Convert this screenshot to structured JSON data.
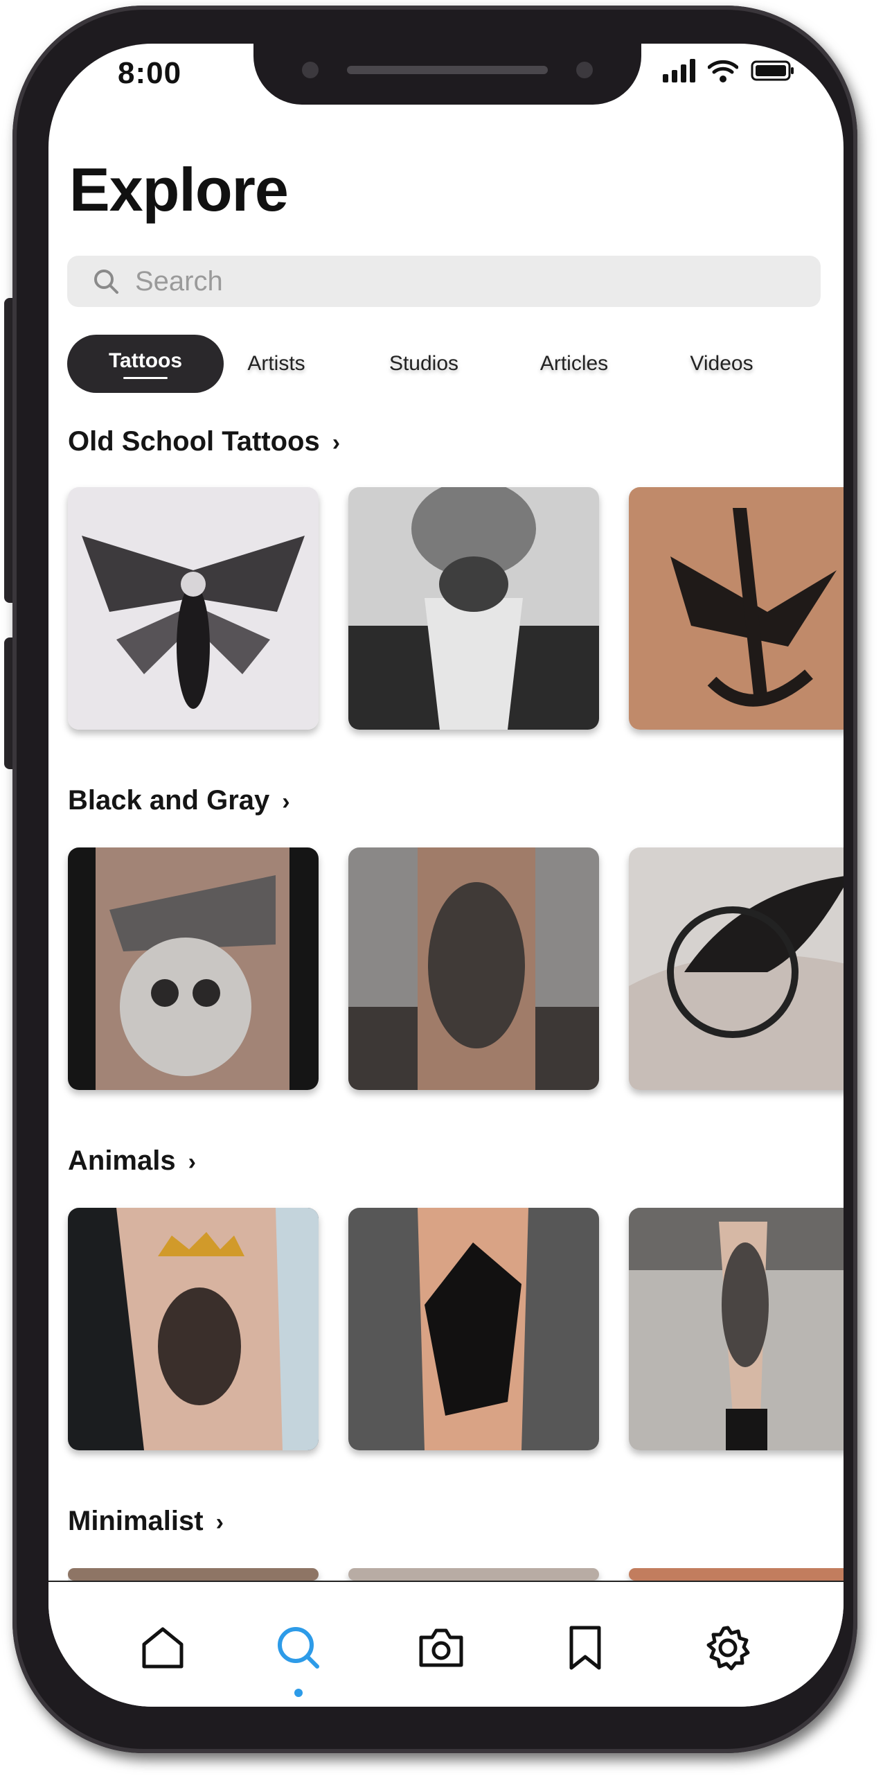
{
  "status_bar": {
    "time": "8:00"
  },
  "page_title": "Explore",
  "search": {
    "placeholder": "Search"
  },
  "tabs": [
    {
      "label": "Tattoos",
      "active": true
    },
    {
      "label": "Artists"
    },
    {
      "label": "Studios"
    },
    {
      "label": "Articles"
    },
    {
      "label": "Videos"
    }
  ],
  "sections": [
    {
      "title": "Old School Tattoos",
      "chevron": "›"
    },
    {
      "title": "Black and Gray",
      "chevron": "›"
    },
    {
      "title": "Animals",
      "chevron": "›"
    },
    {
      "title": "Minimalist",
      "chevron": "›"
    }
  ],
  "bottom_nav": [
    {
      "icon": "home-icon"
    },
    {
      "icon": "search-icon",
      "active": true
    },
    {
      "icon": "camera-icon"
    },
    {
      "icon": "bookmark-icon"
    },
    {
      "icon": "settings-icon"
    }
  ],
  "colors": {
    "accent": "#2d9be8",
    "dark": "#2a282b"
  }
}
